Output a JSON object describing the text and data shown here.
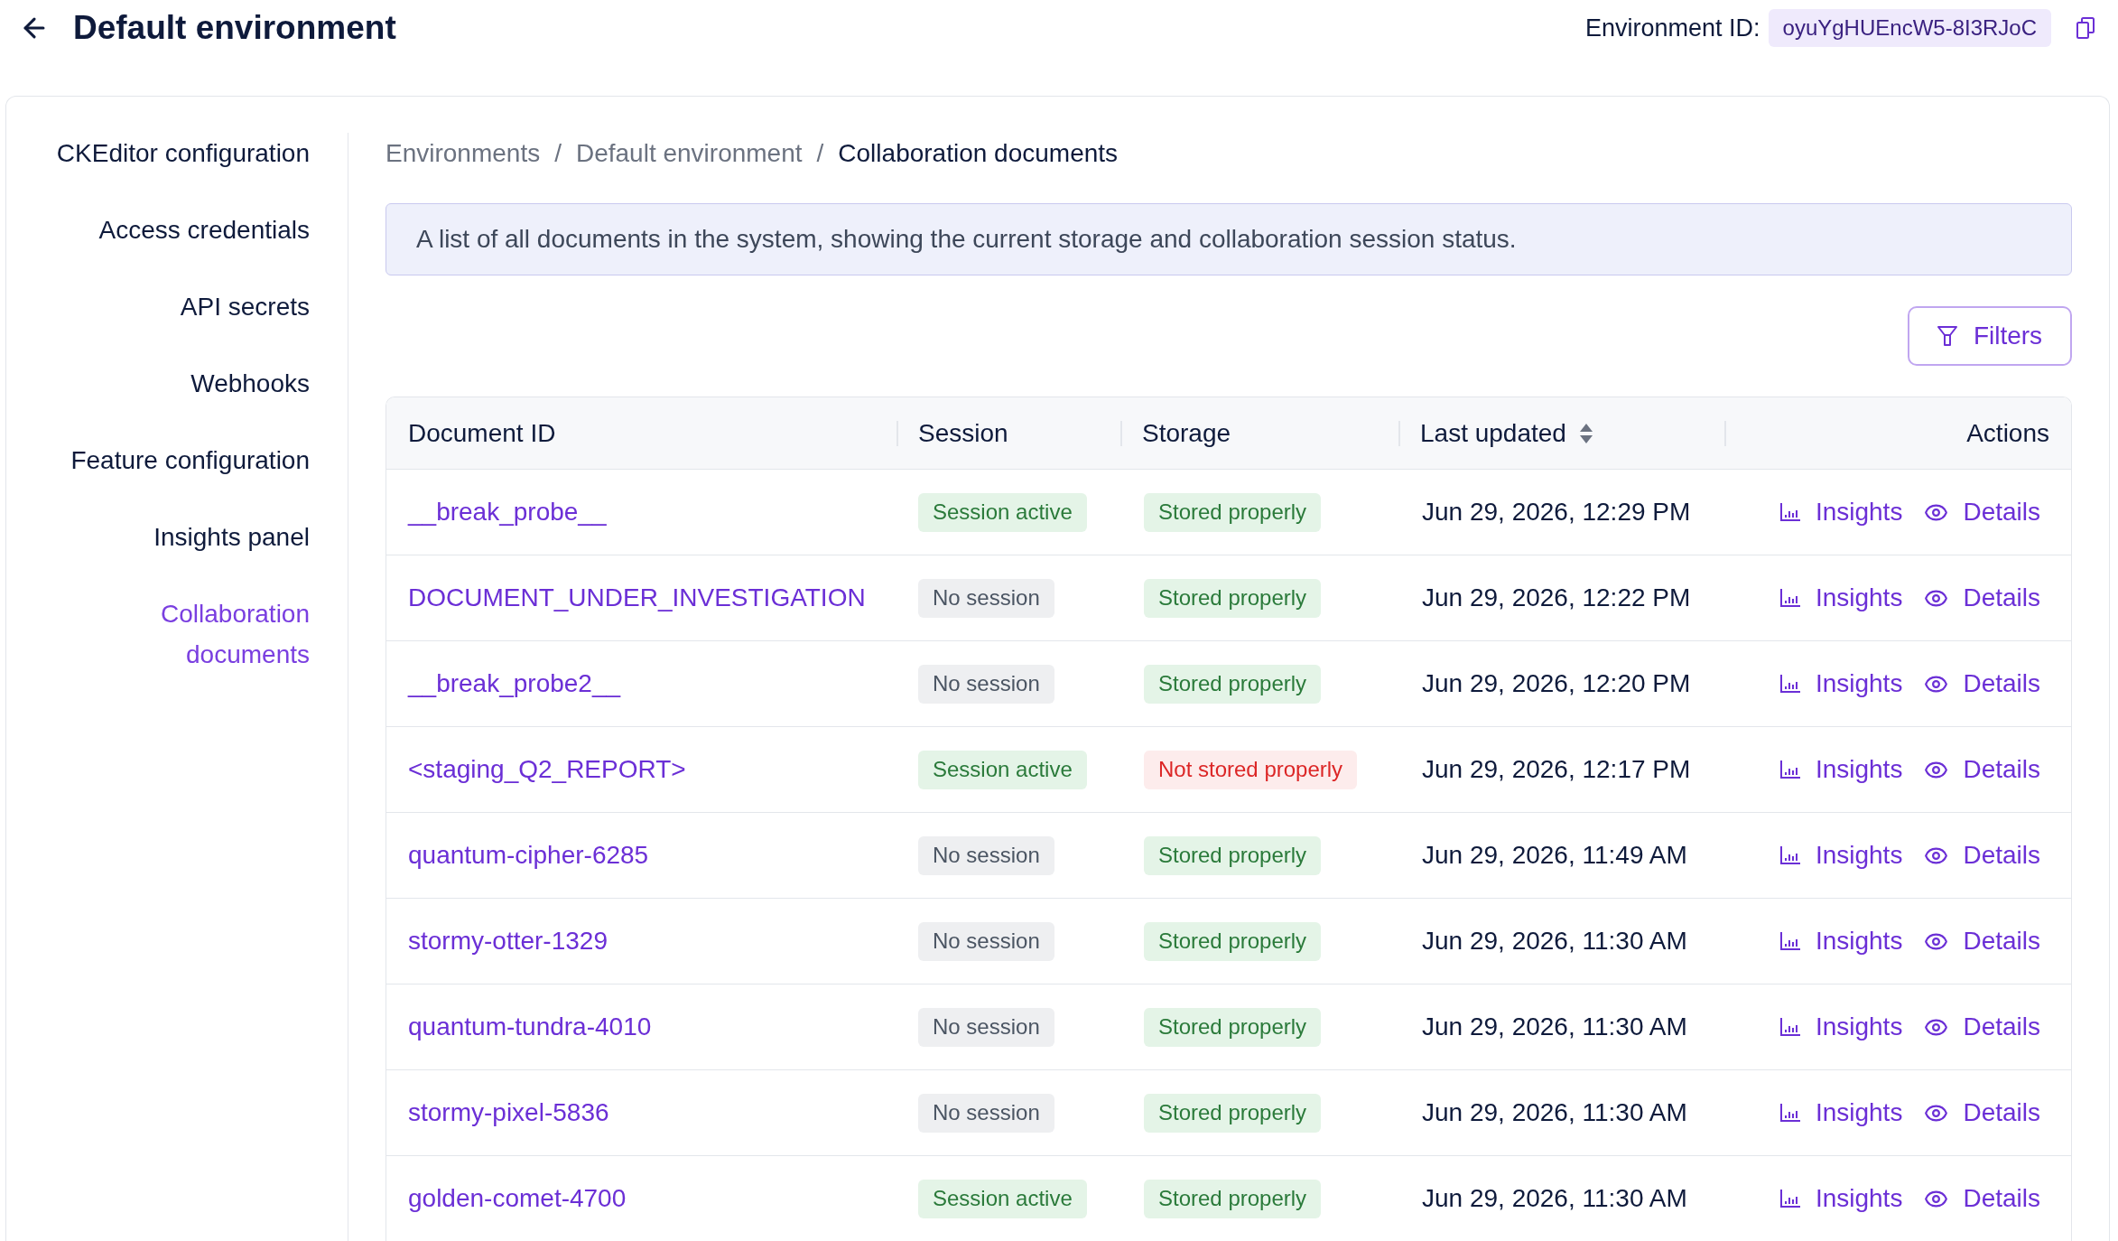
{
  "header": {
    "title": "Default environment",
    "environment_id_label": "Environment ID:",
    "environment_id": "oyuYgHUEncW5-8I3RJoC"
  },
  "sidebar": {
    "items": [
      {
        "label": "CKEditor configuration",
        "selected": false
      },
      {
        "label": "Access credentials",
        "selected": false
      },
      {
        "label": "API secrets",
        "selected": false
      },
      {
        "label": "Webhooks",
        "selected": false
      },
      {
        "label": "Feature configuration",
        "selected": false
      },
      {
        "label": "Insights panel",
        "selected": false
      },
      {
        "label": "Collaboration documents",
        "selected": true
      }
    ]
  },
  "breadcrumb": {
    "items": [
      {
        "label": "Environments",
        "current": false
      },
      {
        "label": "Default environment",
        "current": false
      },
      {
        "label": "Collaboration documents",
        "current": true
      }
    ],
    "separators": [
      "/",
      "/"
    ]
  },
  "info_message": "A list of all documents in the system, showing the current storage and collaboration session status.",
  "filters_button": "Filters",
  "table": {
    "columns": [
      {
        "label": "Document ID",
        "sortable": false
      },
      {
        "label": "Session",
        "sortable": false
      },
      {
        "label": "Storage",
        "sortable": false
      },
      {
        "label": "Last updated",
        "sortable": true
      },
      {
        "label": "Actions",
        "sortable": false
      }
    ],
    "rows": [
      {
        "document_id": "__break_probe__",
        "session": {
          "kind": "active",
          "label": "Session active"
        },
        "storage": {
          "kind": "ok",
          "label": "Stored properly"
        },
        "last_updated": "Jun 29, 2026, 12:29 PM",
        "actions": [
          {
            "kind": "insights",
            "label": "Insights"
          },
          {
            "kind": "details",
            "label": "Details"
          }
        ]
      },
      {
        "document_id": "DOCUMENT_UNDER_INVESTIGATION",
        "session": {
          "kind": "none",
          "label": "No session"
        },
        "storage": {
          "kind": "ok",
          "label": "Stored properly"
        },
        "last_updated": "Jun 29, 2026, 12:22 PM",
        "actions": [
          {
            "kind": "insights",
            "label": "Insights"
          },
          {
            "kind": "details",
            "label": "Details"
          }
        ]
      },
      {
        "document_id": "__break_probe2__",
        "session": {
          "kind": "none",
          "label": "No session"
        },
        "storage": {
          "kind": "ok",
          "label": "Stored properly"
        },
        "last_updated": "Jun 29, 2026, 12:20 PM",
        "actions": [
          {
            "kind": "insights",
            "label": "Insights"
          },
          {
            "kind": "details",
            "label": "Details"
          }
        ]
      },
      {
        "document_id": "<staging_Q2_REPORT>",
        "session": {
          "kind": "active",
          "label": "Session active"
        },
        "storage": {
          "kind": "error",
          "label": "Not stored properly"
        },
        "last_updated": "Jun 29, 2026, 12:17 PM",
        "actions": [
          {
            "kind": "insights",
            "label": "Insights"
          },
          {
            "kind": "details",
            "label": "Details"
          }
        ]
      },
      {
        "document_id": "quantum-cipher-6285",
        "session": {
          "kind": "none",
          "label": "No session"
        },
        "storage": {
          "kind": "ok",
          "label": "Stored properly"
        },
        "last_updated": "Jun 29, 2026, 11:49 AM",
        "actions": [
          {
            "kind": "insights",
            "label": "Insights"
          },
          {
            "kind": "details",
            "label": "Details"
          }
        ]
      },
      {
        "document_id": "stormy-otter-1329",
        "session": {
          "kind": "none",
          "label": "No session"
        },
        "storage": {
          "kind": "ok",
          "label": "Stored properly"
        },
        "last_updated": "Jun 29, 2026, 11:30 AM",
        "actions": [
          {
            "kind": "insights",
            "label": "Insights"
          },
          {
            "kind": "details",
            "label": "Details"
          }
        ]
      },
      {
        "document_id": "quantum-tundra-4010",
        "session": {
          "kind": "none",
          "label": "No session"
        },
        "storage": {
          "kind": "ok",
          "label": "Stored properly"
        },
        "last_updated": "Jun 29, 2026, 11:30 AM",
        "actions": [
          {
            "kind": "insights",
            "label": "Insights"
          },
          {
            "kind": "details",
            "label": "Details"
          }
        ]
      },
      {
        "document_id": "stormy-pixel-5836",
        "session": {
          "kind": "none",
          "label": "No session"
        },
        "storage": {
          "kind": "ok",
          "label": "Stored properly"
        },
        "last_updated": "Jun 29, 2026, 11:30 AM",
        "actions": [
          {
            "kind": "insights",
            "label": "Insights"
          },
          {
            "kind": "details",
            "label": "Details"
          }
        ]
      },
      {
        "document_id": "golden-comet-4700",
        "session": {
          "kind": "active",
          "label": "Session active"
        },
        "storage": {
          "kind": "ok",
          "label": "Stored properly"
        },
        "last_updated": "Jun 29, 2026, 11:30 AM",
        "actions": [
          {
            "kind": "insights",
            "label": "Insights"
          },
          {
            "kind": "details",
            "label": "Details"
          }
        ]
      }
    ]
  }
}
